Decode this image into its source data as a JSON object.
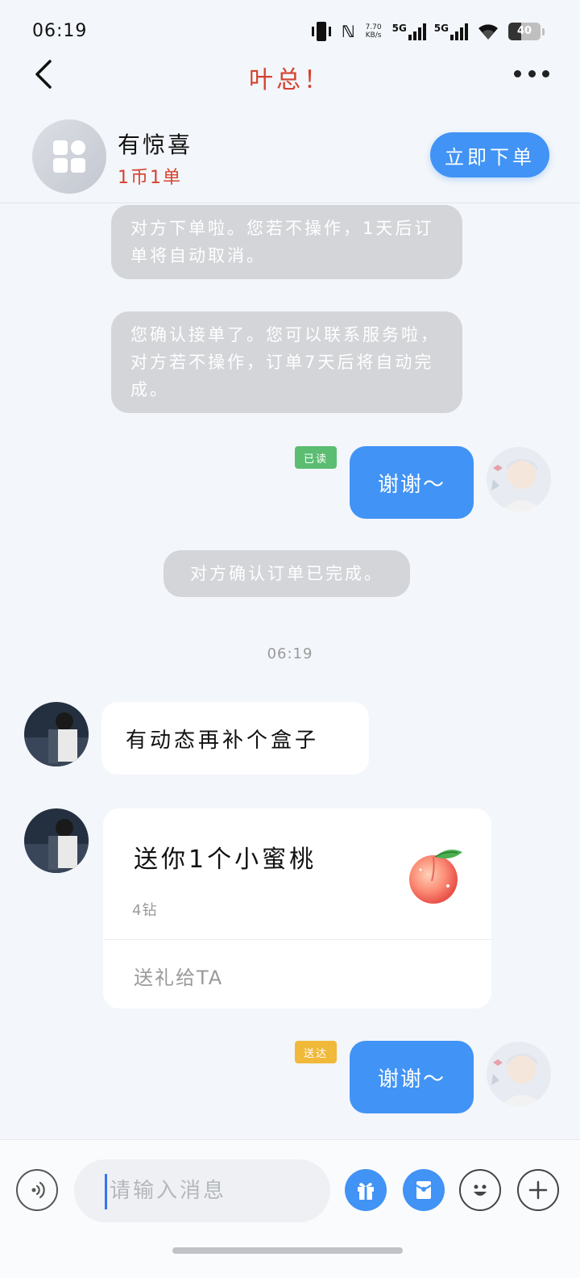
{
  "status_bar": {
    "time": "06:19",
    "net_speed": "7.70 KB/s",
    "signal_1": "5G",
    "signal_2": "5G",
    "battery": "40",
    "battery_level": 0.4
  },
  "header": {
    "title": "叶总！"
  },
  "shop": {
    "name": "有惊喜",
    "price": "1币1单",
    "order_button": "立即下单"
  },
  "messages": {
    "sys_1": "对方下单啦。您若不操作，1天后订单将自动取消。",
    "sys_2": "您确认接单了。您可以联系服务啦，对方若不操作，订单7天后将自动完成。",
    "read_badge": "已读",
    "thanks_1": "谢谢～",
    "sys_3": "对方确认订单已完成。",
    "timestamp": "06:19",
    "left_1": "有动态再补个盒子",
    "gift_title": "送你1个小蜜桃",
    "gift_price": "4钻",
    "gift_link": "送礼给TA",
    "delivered_badge": "送达",
    "thanks_2": "谢谢～"
  },
  "input": {
    "placeholder": "请输入消息"
  },
  "colors": {
    "accent": "#4193f5",
    "title_red": "#d4432f",
    "read_green": "#5bbd72",
    "delivered_yellow": "#f0b93a",
    "system_bubble": "#d3d5d8"
  }
}
